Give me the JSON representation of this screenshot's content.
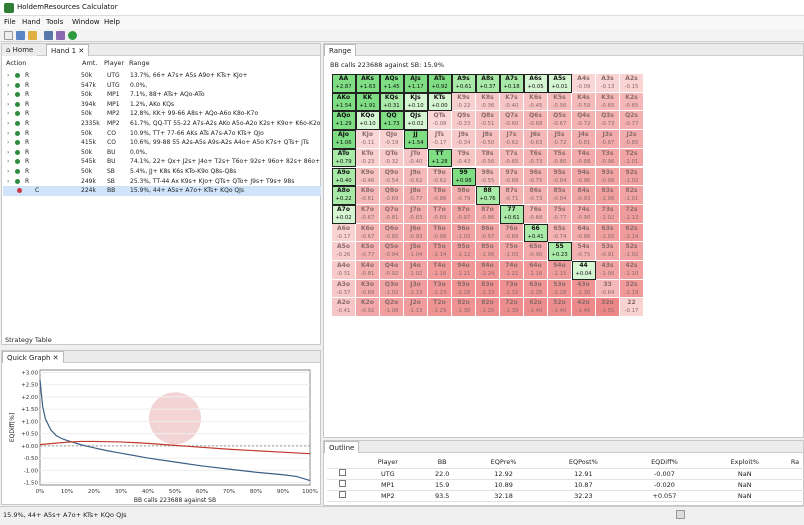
{
  "window": {
    "title": "HoldemResources Calculator"
  },
  "menu": [
    "File",
    "Hand",
    "Tools",
    "Window",
    "Help"
  ],
  "tabs": {
    "home": "Home",
    "hand": "Hand 1",
    "strategy": "Strategy Table",
    "quick": "Quick Graph",
    "range": "Range",
    "outline": "Outline"
  },
  "action_table": {
    "headers": [
      "Action",
      "Amt.",
      "Player",
      "Range"
    ],
    "rows": [
      {
        "action": "R",
        "amt": "50k",
        "player": "UTG",
        "range": "13.7%, 66+ A7s+ A5s A9o+ KTs+ KJo+"
      },
      {
        "action": "R",
        "amt": "547k",
        "player": "UTG",
        "range": "0.0%,"
      },
      {
        "action": "R",
        "amt": "50k",
        "player": "MP1",
        "range": "7.1%, 88+ ATs+ AQo-ATo"
      },
      {
        "action": "R",
        "amt": "394k",
        "player": "MP1",
        "range": "1.2%, AKo KQs"
      },
      {
        "action": "R",
        "amt": "50k",
        "player": "MP2",
        "range": "12.8%, KK+ 99-66 A8s+ AQo-A6o K8o-K7o"
      },
      {
        "action": "R",
        "amt": "2335k",
        "player": "MP2",
        "range": "61.7%, QQ-TT 55-22 A7s-A2s AKo A5o-A2o K2s+ K9o+ K6o-K2o"
      },
      {
        "action": "R",
        "amt": "50k",
        "player": "CO",
        "range": "10.9%, TT+ 77-66 AKs ATs A7s-A7o KTs+ QJo"
      },
      {
        "action": "R",
        "amt": "415k",
        "player": "CO",
        "range": "10.6%, 99-88 55 A2s-A5s A9s-A2s A4o+ A5o K7s+ QTs+ JTs"
      },
      {
        "action": "R",
        "amt": "50k",
        "player": "BU",
        "range": "0.0%,"
      },
      {
        "action": "R",
        "amt": "545k",
        "player": "BU",
        "range": "74.1%, 22+ Qx+ J2s+ J4o+ T2s+ T6o+ 92s+ 96o+ 82s+ 86o+ 73s"
      },
      {
        "action": "R",
        "amt": "50k",
        "player": "SB",
        "range": "5.4%, JJ+ K8s K6s KTo-K9o Q8s-Q8s"
      },
      {
        "action": "R",
        "amt": "249k",
        "player": "SB",
        "range": "25.3%, TT-44 Ax K9s+ KJo+ QTs+ QTo+ J9s+ T9s+ 98s"
      },
      {
        "action": "C",
        "amt": "224k",
        "player": "BB",
        "range": "15.9%, 44+ A5s+ A7o+ KTs+ KQo QJs"
      }
    ]
  },
  "quick_graph": {
    "ylabel": "EQDiff[%]",
    "xlabel": "BB calls 223688 against SB",
    "yticks": [
      "+3.00",
      "+2.50",
      "+2.00",
      "+1.50",
      "+1.00",
      "+0.50",
      "+0.00",
      "-0.50",
      "-1.00",
      "-1.50"
    ],
    "xticks": [
      "0%",
      "10%",
      "20%",
      "30%",
      "40%",
      "50%",
      "60%",
      "70%",
      "80%",
      "90%",
      "100%"
    ]
  },
  "chart_data": {
    "type": "line",
    "ylabel": "EQDiff[%]",
    "xlabel": "BB calls 223688 against SB",
    "ylim": [
      -1.6,
      3.1
    ],
    "xlim": [
      0,
      100
    ],
    "series": [
      {
        "name": "",
        "color": "#3b5f86",
        "x": [
          0,
          1,
          2,
          4,
          6,
          8,
          10,
          15,
          20,
          25,
          30,
          40,
          50,
          60,
          70,
          80,
          90,
          95,
          100
        ],
        "y": [
          2.7,
          1.6,
          1.1,
          0.65,
          0.42,
          0.3,
          0.22,
          0.05,
          -0.08,
          -0.2,
          -0.3,
          -0.5,
          -0.66,
          -0.82,
          -0.95,
          -1.08,
          -1.18,
          -1.25,
          -1.42
        ]
      },
      {
        "name": "",
        "color": "#c0392b",
        "x": [
          0,
          5,
          10,
          15,
          20,
          30,
          40,
          50,
          60,
          70,
          80,
          90,
          100
        ],
        "y": [
          0.05,
          0.1,
          0.15,
          0.18,
          0.18,
          0.16,
          0.1,
          0.02,
          -0.06,
          -0.14,
          -0.2,
          -0.26,
          -0.32
        ]
      }
    ]
  },
  "range_header": "BB calls 223688 against SB: 15.9%",
  "hands": [
    [
      "AA",
      "AKs",
      "AQs",
      "AJs",
      "ATs",
      "A9s",
      "A8s",
      "A7s",
      "A6s",
      "A5s",
      "A4s",
      "A3s",
      "A2s"
    ],
    [
      "AKo",
      "KK",
      "KQs",
      "KJs",
      "KTs",
      "K9s",
      "K8s",
      "K7s",
      "K6s",
      "K5s",
      "K4s",
      "K3s",
      "K2s"
    ],
    [
      "AQo",
      "KQo",
      "QQ",
      "QJs",
      "QTs",
      "Q9s",
      "Q8s",
      "Q7s",
      "Q6s",
      "Q5s",
      "Q4s",
      "Q3s",
      "Q2s"
    ],
    [
      "AJo",
      "KJo",
      "QJo",
      "JJ",
      "JTs",
      "J9s",
      "J8s",
      "J7s",
      "J6s",
      "J5s",
      "J4s",
      "J3s",
      "J2s"
    ],
    [
      "ATo",
      "KTo",
      "QTo",
      "JTo",
      "TT",
      "T9s",
      "T8s",
      "T7s",
      "T6s",
      "T5s",
      "T4s",
      "T3s",
      "T2s"
    ],
    [
      "A9o",
      "K9o",
      "Q9o",
      "J9o",
      "T9o",
      "99",
      "98s",
      "97s",
      "96s",
      "95s",
      "94s",
      "93s",
      "92s"
    ],
    [
      "A8o",
      "K8o",
      "Q8o",
      "J8o",
      "T8o",
      "98o",
      "88",
      "87s",
      "86s",
      "85s",
      "84s",
      "83s",
      "82s"
    ],
    [
      "A7o",
      "K7o",
      "Q7o",
      "J7o",
      "T7o",
      "97o",
      "87o",
      "77",
      "76s",
      "75s",
      "74s",
      "73s",
      "72s"
    ],
    [
      "A6o",
      "K6o",
      "Q6o",
      "J6o",
      "T6o",
      "96o",
      "86o",
      "76o",
      "66",
      "65s",
      "64s",
      "63s",
      "62s"
    ],
    [
      "A5o",
      "K5o",
      "Q5o",
      "J5o",
      "T5o",
      "95o",
      "85o",
      "75o",
      "65o",
      "55",
      "54s",
      "53s",
      "52s"
    ],
    [
      "A4o",
      "K4o",
      "Q4o",
      "J4o",
      "T4o",
      "94o",
      "84o",
      "74o",
      "64o",
      "54o",
      "44",
      "43s",
      "42s"
    ],
    [
      "A3o",
      "K3o",
      "Q3o",
      "J3o",
      "T3o",
      "93o",
      "83o",
      "73o",
      "63o",
      "53o",
      "43o",
      "33",
      "32s"
    ],
    [
      "A2o",
      "K2o",
      "Q2o",
      "J2o",
      "T2o",
      "92o",
      "82o",
      "72o",
      "62o",
      "52o",
      "42o",
      "32o",
      "22"
    ]
  ],
  "evs": [
    [
      "+2.87",
      "+1.63",
      "+1.45",
      "+1.17",
      "+0.92",
      "+0.61",
      "+0.37",
      "+0.18",
      "+0.05",
      "+0.01",
      "-0.09",
      "-0.13",
      "-0.15"
    ],
    [
      "+1.54",
      "+1.91",
      "+0.31",
      "+0.10",
      "+0.00",
      "-0.22",
      "-0.36",
      "-0.40",
      "-0.45",
      "-0.56",
      "-0.59",
      "-0.65",
      "-0.65"
    ],
    [
      "+1.29",
      "+0.10",
      "+1.73",
      "+0.02",
      "-0.08",
      "-0.33",
      "-0.51",
      "-0.60",
      "-0.68",
      "-0.67",
      "-0.72",
      "-0.73",
      "-0.77"
    ],
    [
      "+1.06",
      "-0.11",
      "-0.19",
      "+1.54",
      "-0.17",
      "-0.34",
      "-0.50",
      "-0.62",
      "-0.63",
      "-0.72",
      "-0.81",
      "-0.87",
      "-0.85"
    ],
    [
      "+0.79",
      "-0.23",
      "-0.32",
      "-0.40",
      "+1.28",
      "-0.43",
      "-0.56",
      "-0.65",
      "-0.73",
      "-0.80",
      "-0.88",
      "-0.96",
      "-1.01"
    ],
    [
      "+0.40",
      "-0.46",
      "-0.54",
      "-0.62",
      "-0.62",
      "+0.98",
      "-0.55",
      "-0.68",
      "-0.75",
      "-0.84",
      "-0.96",
      "-0.99",
      "-1.02"
    ],
    [
      "+0.22",
      "-0.61",
      "-0.69",
      "-0.77",
      "-0.86",
      "-0.79",
      "+0.76",
      "-0.71",
      "-0.73",
      "-0.84",
      "-0.93",
      "-1.06",
      "-1.01"
    ],
    [
      "+0.02",
      "-0.67",
      "-0.81",
      "-0.83",
      "-0.89",
      "-0.97",
      "-0.86",
      "+0.61",
      "-0.68",
      "-0.77",
      "-0.90",
      "-1.02",
      "-1.13"
    ],
    [
      "-0.17",
      "-0.67",
      "-0.85",
      "-0.93",
      "-0.98",
      "-1.03",
      "-0.97",
      "-0.89",
      "+0.41",
      "-0.74",
      "-0.86",
      "-1.05",
      "-1.14"
    ],
    [
      "-0.26",
      "-0.77",
      "-0.94",
      "-1.04",
      "-1.14",
      "-1.12",
      "-1.06",
      "-1.03",
      "-0.90",
      "+0.23",
      "-0.75",
      "-0.91",
      "-1.02"
    ],
    [
      "-0.31",
      "-0.81",
      "-0.92",
      "-1.02",
      "-1.16",
      "-1.21",
      "-1.24",
      "-1.22",
      "-1.16",
      "-1.15",
      "+0.04",
      "-1.00",
      "-1.10"
    ],
    [
      "-0.37",
      "-0.89",
      "-1.02",
      "-1.13",
      "-1.23",
      "-1.28",
      "-1.33",
      "-1.32",
      "-1.26",
      "-1.28",
      "-1.30",
      "-0.64",
      "-1.19"
    ],
    [
      "-0.41",
      "-0.92",
      "-1.08",
      "-1.13",
      "-1.29",
      "-1.30",
      "-1.35",
      "-1.39",
      "-1.40",
      "-1.40",
      "-1.46",
      "-1.55",
      "-0.17"
    ]
  ],
  "outline": {
    "headers": [
      "",
      "Player",
      "BB",
      "EQPre%",
      "EQPost%",
      "EQDiff%",
      "Exploit%",
      "Ra"
    ],
    "rows": [
      {
        "player": "UTG",
        "bb": "22.0",
        "eqpre": "12.92",
        "eqpost": "12.91",
        "eqdiff": "-0.007",
        "exploit": "NaN"
      },
      {
        "player": "MP1",
        "bb": "15.9",
        "eqpre": "10.89",
        "eqpost": "10.87",
        "eqdiff": "-0.020",
        "exploit": "NaN"
      },
      {
        "player": "MP2",
        "bb": "93.5",
        "eqpre": "32.18",
        "eqpost": "32.23",
        "eqdiff": "+0.057",
        "exploit": "NaN"
      }
    ]
  },
  "status": {
    "text": "15.9%, 44+ A5s+ A7o+ KTs+ KQo QJs"
  },
  "colors": {
    "green": "#86e08a",
    "light_green": "#ccf5cc",
    "pink_light": "#fbdada",
    "pink_dark": "#f19a9a"
  }
}
